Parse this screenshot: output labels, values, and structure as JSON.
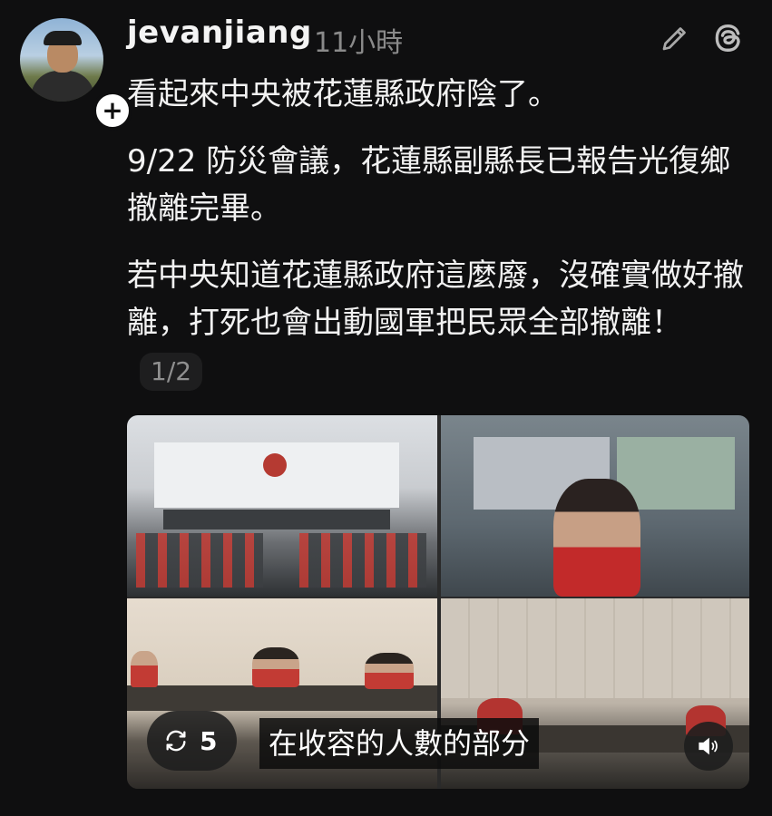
{
  "post": {
    "username": "jevanjiang",
    "timestamp": "11小時",
    "paragraphs": [
      "看起來中央被花蓮縣政府陰了。",
      "9/22 防災會議，花蓮縣副縣長已報告光復鄉撤離完畢。",
      "若中央知道花蓮縣政府這麼廢，沒確實做好撤離，打死也會出動國軍把民眾全部撤離！"
    ],
    "page_indicator": "1/2"
  },
  "media": {
    "repost_count": "5",
    "caption": "在收容的人數的部分"
  },
  "icons": {
    "follow": "plus-icon",
    "edit": "pencil-icon",
    "app": "threads-logo-icon",
    "repost": "repost-icon",
    "sound": "speaker-icon"
  },
  "colors": {
    "background": "#0f0f10",
    "text": "#f2f2f2",
    "muted": "#8a8a8a"
  }
}
